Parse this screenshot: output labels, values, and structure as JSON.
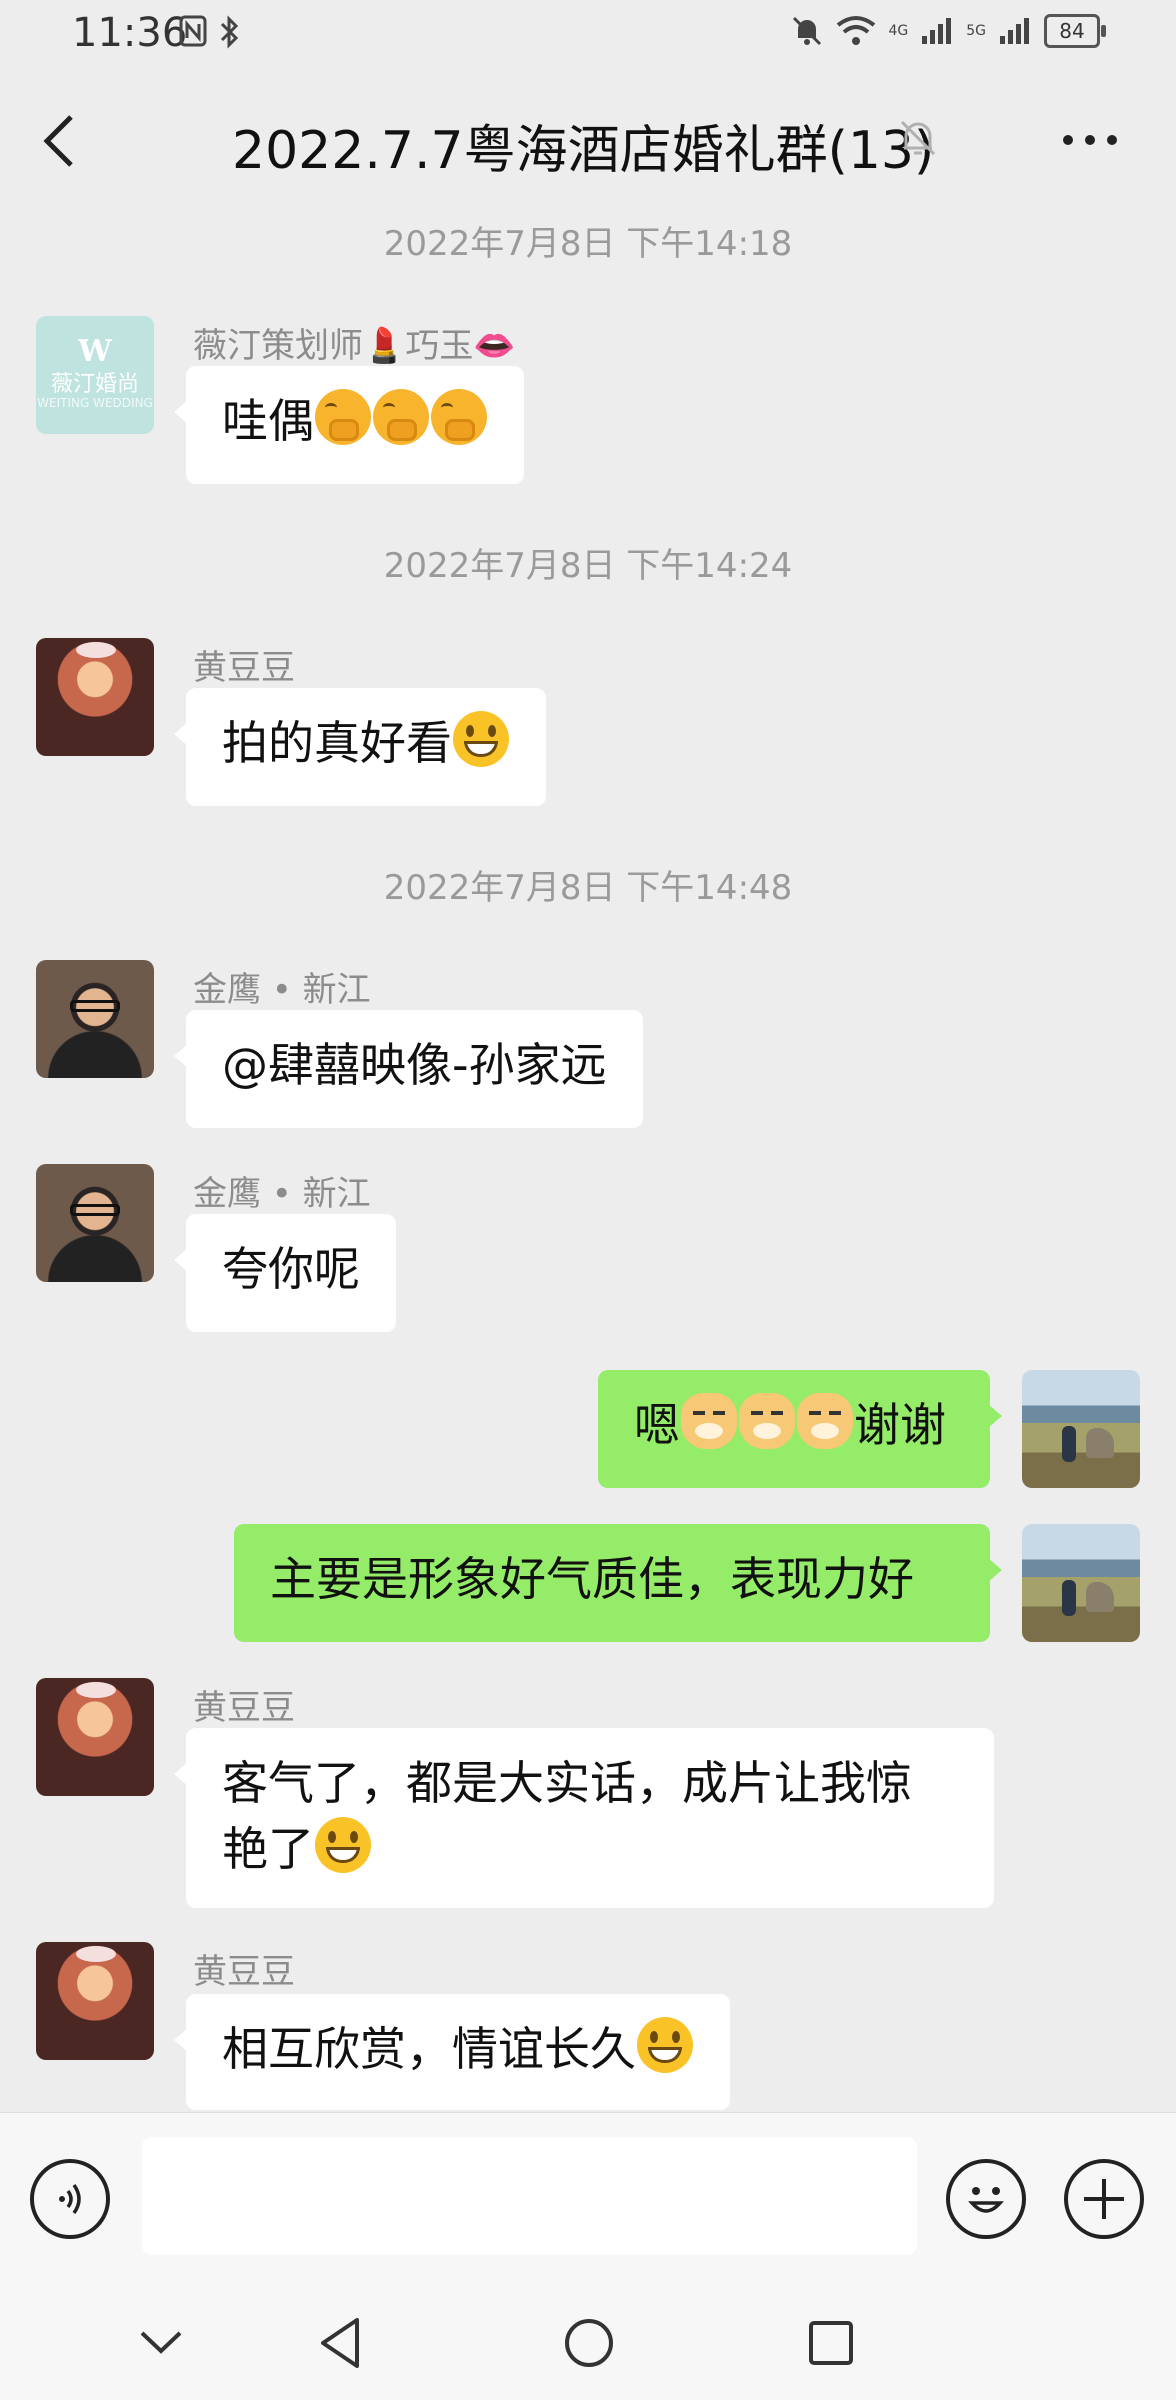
{
  "status_bar": {
    "time": "11:36",
    "network_1": "4G",
    "network_2": "5G",
    "battery": "84"
  },
  "header": {
    "title": "2022.7.7粤海酒店婚礼群(13)"
  },
  "messages": [
    {
      "type": "timestamp",
      "text": "2022年7月8日 下午14:18"
    },
    {
      "type": "incoming",
      "sender": "薇汀策划师💄巧玉👄",
      "text": "哇偶",
      "avatar": "weiting-logo-avatar"
    },
    {
      "type": "timestamp",
      "text": "2022年7月8日 下午14:24"
    },
    {
      "type": "incoming",
      "sender": "黄豆豆",
      "text": "拍的真好看",
      "avatar": "girl-portrait-avatar"
    },
    {
      "type": "timestamp",
      "text": "2022年7月8日 下午14:48"
    },
    {
      "type": "incoming",
      "sender": "金鹰 • 新江",
      "text": "@肆囍映像-孙家远",
      "avatar": "man-portrait-avatar"
    },
    {
      "type": "incoming",
      "sender": "金鹰 • 新江",
      "text": "夸你呢",
      "avatar": "man-portrait-avatar"
    },
    {
      "type": "outgoing",
      "text_before": "嗯",
      "text_after": "谢谢",
      "avatar": "landscape-avatar"
    },
    {
      "type": "outgoing",
      "text": "主要是形象好气质佳，表现力好",
      "avatar": "landscape-avatar"
    },
    {
      "type": "incoming",
      "sender": "黄豆豆",
      "line1": "客气了，都是大实话，成片让我惊",
      "line2": "艳了",
      "avatar": "girl-portrait-avatar"
    },
    {
      "type": "incoming",
      "sender": "黄豆豆",
      "text": "相互欣赏，情谊长久",
      "avatar": "girl-portrait-avatar"
    }
  ],
  "input_bar": {
    "placeholder": "",
    "value": ""
  },
  "avatar_text": {
    "logo_letter": "W",
    "logo_name": "薇汀婚尚",
    "logo_sub": "WEITING WEDDING"
  },
  "colors": {
    "background": "#ededed",
    "outgoing_bubble": "#95ec69",
    "incoming_bubble": "#ffffff",
    "timestamp": "#9a9a9a"
  }
}
